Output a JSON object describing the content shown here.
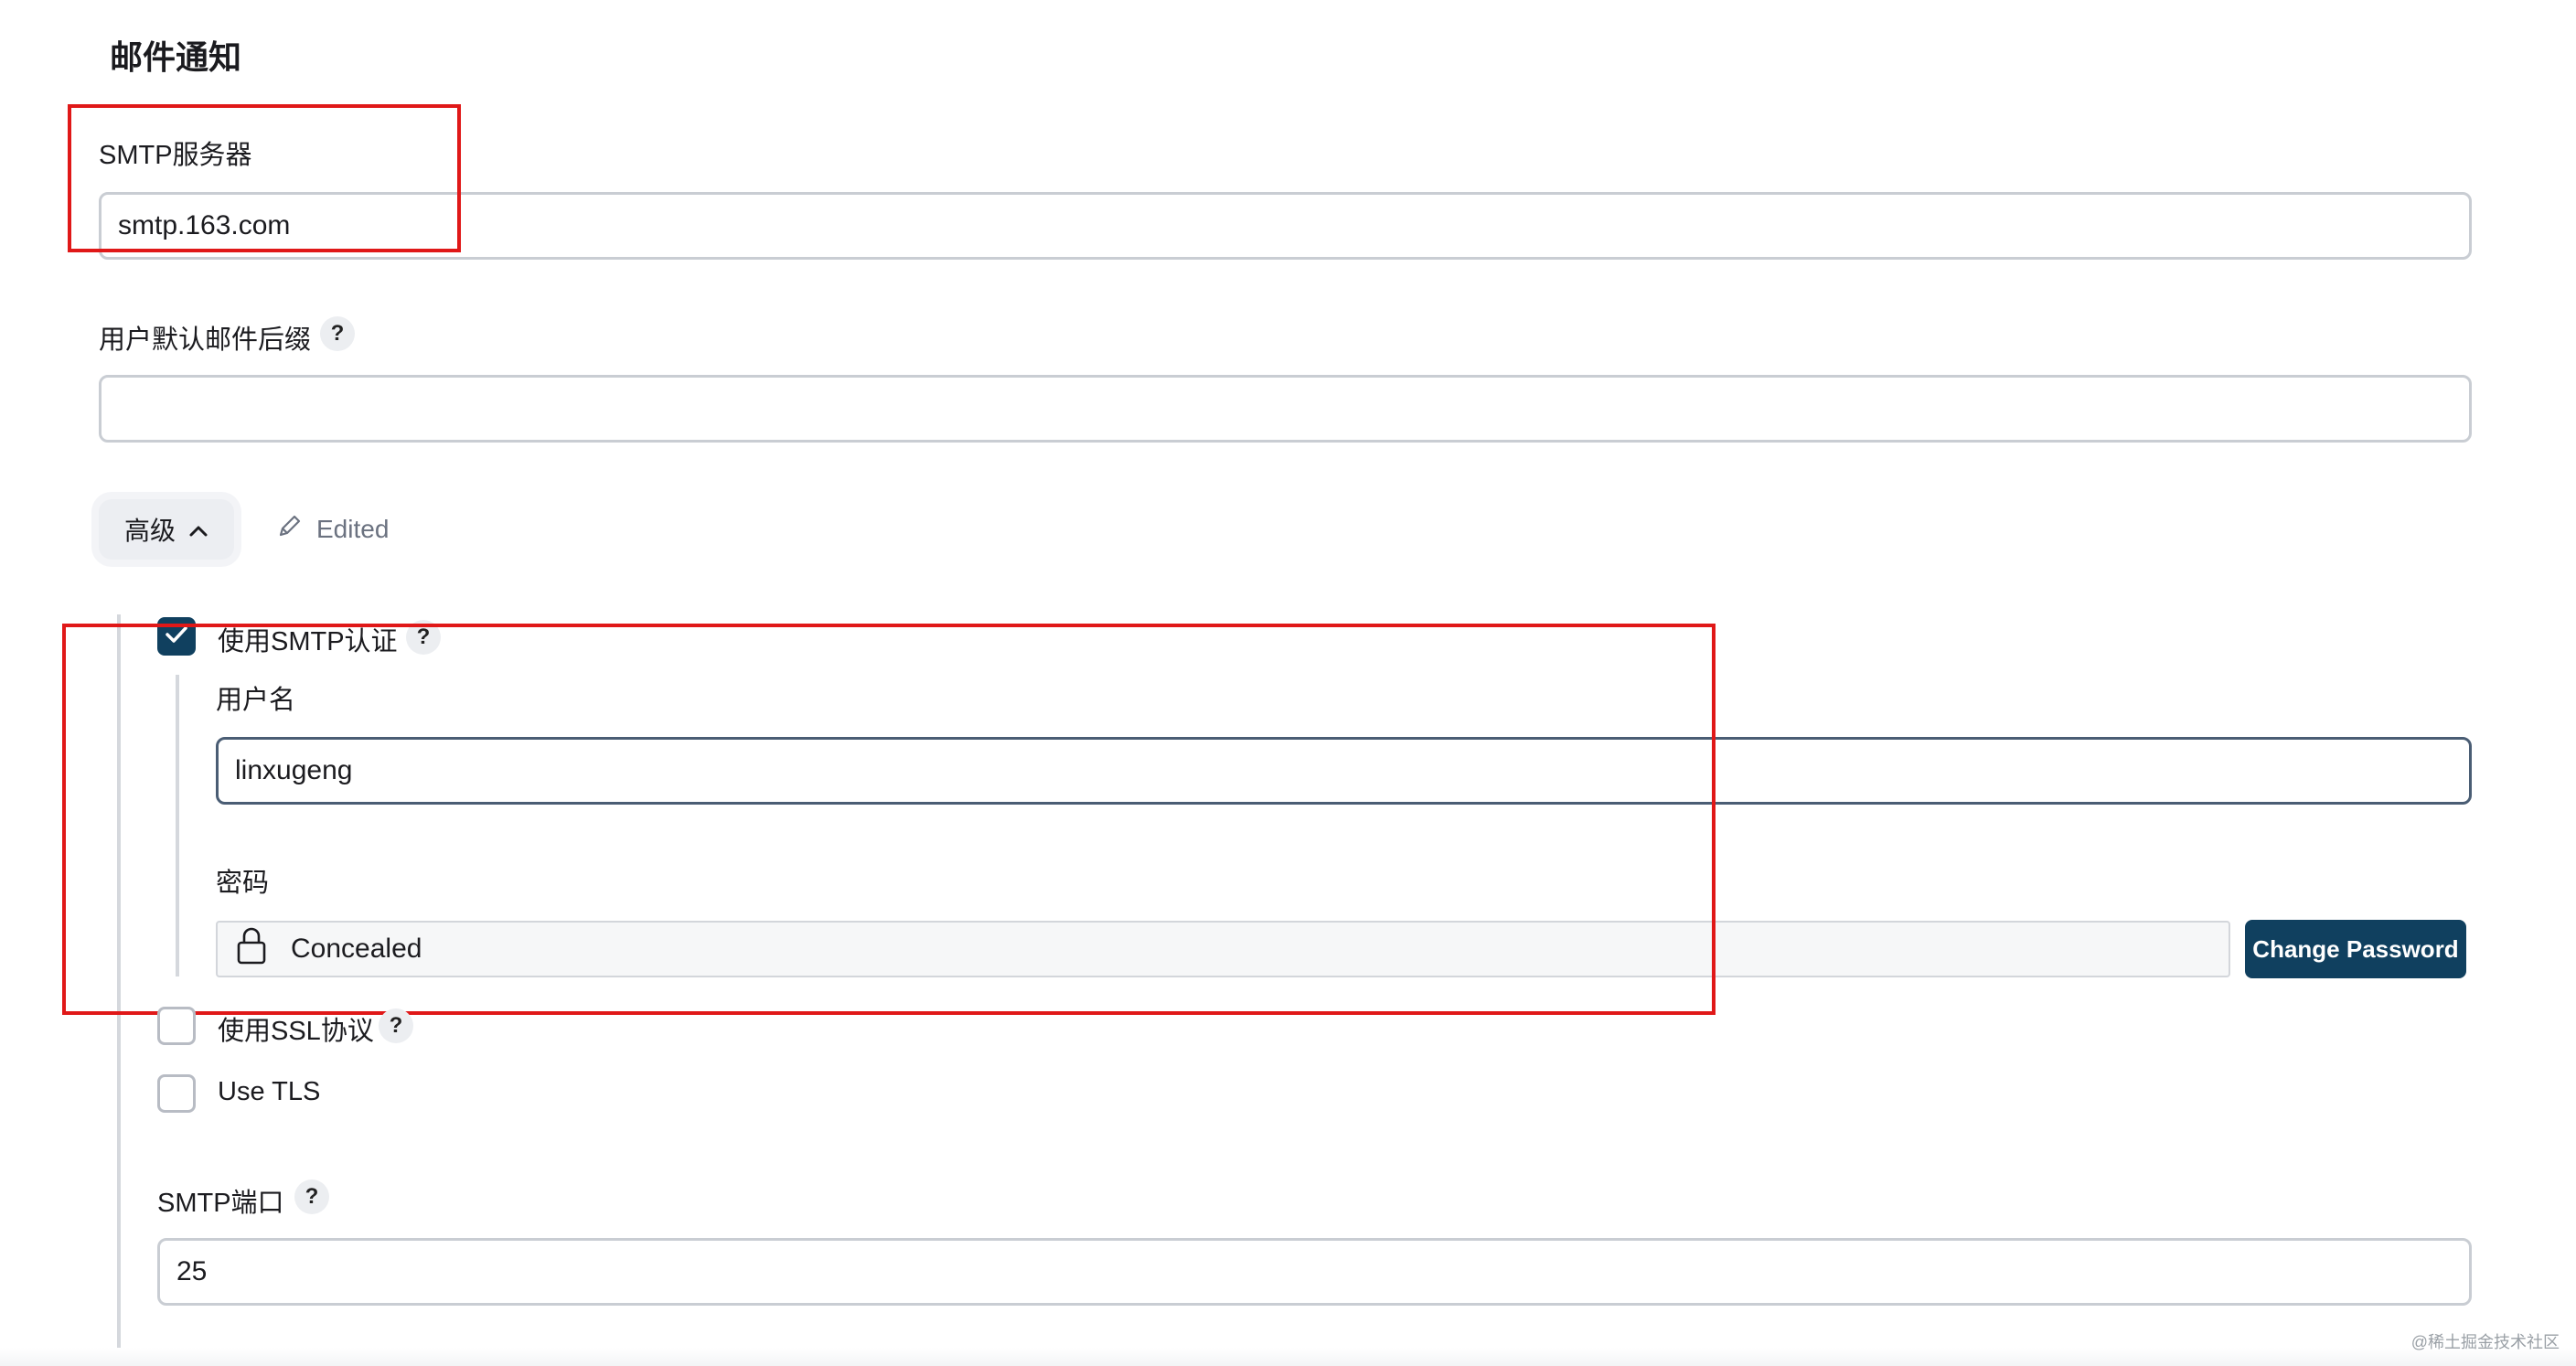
{
  "section": {
    "title": "邮件通知"
  },
  "smtp_server": {
    "label": "SMTP服务器",
    "value": "smtp.163.com"
  },
  "default_suffix": {
    "label": "用户默认邮件后缀",
    "help": "?",
    "value": ""
  },
  "advanced": {
    "label": "高级",
    "edited": "Edited"
  },
  "smtp_auth": {
    "label": "使用SMTP认证",
    "help": "?",
    "checked": true,
    "username_label": "用户名",
    "username_value": "linxugeng",
    "password_label": "密码",
    "password_value": "Concealed",
    "change_password": "Change Password"
  },
  "ssl": {
    "label": "使用SSL协议",
    "help": "?",
    "checked": false
  },
  "tls": {
    "label": "Use TLS",
    "checked": false
  },
  "smtp_port": {
    "label": "SMTP端口",
    "help": "?",
    "value": "25"
  },
  "watermark": "@稀土掘金技术社区",
  "colors": {
    "primary": "#10405f",
    "annotation_red": "#e01818",
    "border": "#c9cdd3"
  },
  "icons": [
    "chevron-up-icon",
    "pencil-icon",
    "check-icon",
    "lock-icon"
  ]
}
